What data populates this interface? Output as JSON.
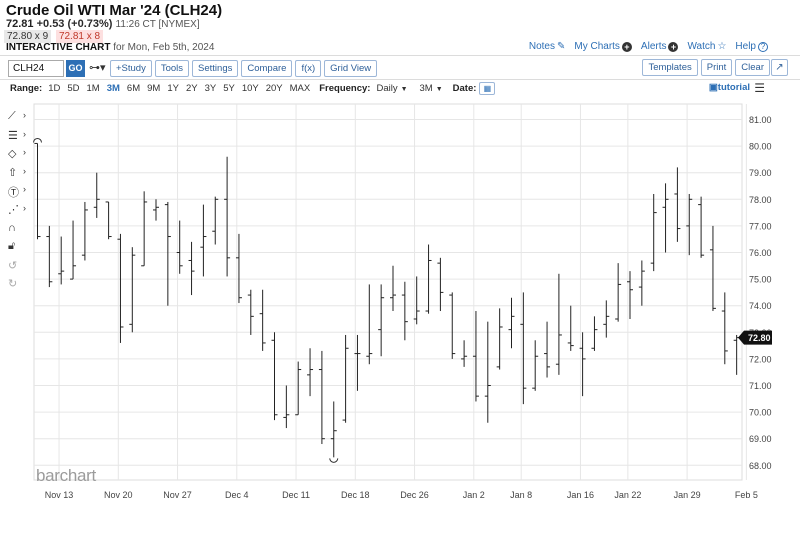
{
  "header": {
    "title": "Crude Oil WTI Mar '24 (CLH24)",
    "last": "72.81",
    "change": "+0.53 (+0.73%)",
    "time": "11:26 CT [NYMEX]",
    "bid": "72.80 x 9",
    "ask": "72.81 x 8",
    "chart_type_label": "INTERACTIVE CHART",
    "for_date": "for Mon, Feb 5th, 2024"
  },
  "links": {
    "notes": "Notes",
    "my_charts": "My Charts",
    "alerts": "Alerts",
    "watch": "Watch",
    "help": "Help"
  },
  "toolbar": {
    "symbol": "CLH24",
    "go": "GO",
    "study": "+Study",
    "tools": "Tools",
    "settings": "Settings",
    "compare": "Compare",
    "fx": "f(x)",
    "grid_view": "Grid View",
    "templates": "Templates",
    "print": "Print",
    "clear": "Clear"
  },
  "rangebar": {
    "range_label": "Range:",
    "ranges": [
      "1D",
      "5D",
      "1M",
      "3M",
      "6M",
      "9M",
      "1Y",
      "2Y",
      "3Y",
      "5Y",
      "10Y",
      "20Y",
      "MAX"
    ],
    "active_range": "3M",
    "frequency_label": "Frequency:",
    "frequency": "Daily",
    "period": "3M",
    "date_label": "Date:",
    "tutorial": "tutorial"
  },
  "logo": "barchart",
  "colors": {
    "accent": "#2d6fb5",
    "bars": "#222222",
    "grid": "#e6e6e6"
  },
  "chart_data": {
    "type": "ohlc",
    "title": "",
    "xlabel": "",
    "ylabel": "",
    "ylim": [
      67.5,
      81.5
    ],
    "yticks": [
      "81.00",
      "80.00",
      "79.00",
      "78.00",
      "77.00",
      "76.00",
      "75.00",
      "74.00",
      "73.00",
      "72.00",
      "71.00",
      "70.00",
      "69.00",
      "68.00"
    ],
    "xticks": [
      "Nov 13",
      "Nov 20",
      "Nov 27",
      "Dec 4",
      "Dec 11",
      "Dec 18",
      "Dec 26",
      "Jan 2",
      "Jan 8",
      "Jan 16",
      "Jan 22",
      "Jan 29",
      "Feb 5"
    ],
    "last_price_label": "72.80",
    "last_price": 72.8,
    "bars": [
      {
        "o": 80.1,
        "h": 80.1,
        "l": 76.5,
        "c": 76.6
      },
      {
        "o": 76.6,
        "h": 77.0,
        "l": 74.7,
        "c": 74.9
      },
      {
        "o": 75.2,
        "h": 76.6,
        "l": 74.8,
        "c": 75.3
      },
      {
        "o": 75.0,
        "h": 77.2,
        "l": 75.0,
        "c": 75.5
      },
      {
        "o": 75.9,
        "h": 77.9,
        "l": 75.7,
        "c": 77.6
      },
      {
        "o": 77.7,
        "h": 79.0,
        "l": 77.3,
        "c": 78.0
      },
      {
        "o": 77.9,
        "h": 77.9,
        "l": 76.5,
        "c": 76.6
      },
      {
        "o": 76.5,
        "h": 76.7,
        "l": 72.6,
        "c": 73.2
      },
      {
        "o": 73.3,
        "h": 76.2,
        "l": 73.0,
        "c": 75.9
      },
      {
        "o": 75.5,
        "h": 78.3,
        "l": 75.5,
        "c": 77.9
      },
      {
        "o": 77.6,
        "h": 78.0,
        "l": 77.2,
        "c": 77.7
      },
      {
        "o": 77.8,
        "h": 77.9,
        "l": 74.0,
        "c": 76.6
      },
      {
        "o": 76.0,
        "h": 77.2,
        "l": 75.2,
        "c": 75.5
      },
      {
        "o": 75.7,
        "h": 76.4,
        "l": 74.4,
        "c": 75.3
      },
      {
        "o": 76.2,
        "h": 77.8,
        "l": 75.1,
        "c": 76.6
      },
      {
        "o": 76.8,
        "h": 78.1,
        "l": 76.3,
        "c": 78.0
      },
      {
        "o": 78.0,
        "h": 79.6,
        "l": 75.1,
        "c": 75.8
      },
      {
        "o": 75.8,
        "h": 76.7,
        "l": 74.1,
        "c": 74.3
      },
      {
        "o": 74.4,
        "h": 74.6,
        "l": 72.9,
        "c": 73.6
      },
      {
        "o": 73.7,
        "h": 74.6,
        "l": 72.3,
        "c": 72.6
      },
      {
        "o": 72.7,
        "h": 73.0,
        "l": 69.7,
        "c": 69.9
      },
      {
        "o": 69.8,
        "h": 71.0,
        "l": 69.4,
        "c": 69.9
      },
      {
        "o": 69.9,
        "h": 71.9,
        "l": 69.9,
        "c": 71.6
      },
      {
        "o": 71.4,
        "h": 72.4,
        "l": 70.6,
        "c": 71.6
      },
      {
        "o": 71.6,
        "h": 72.3,
        "l": 68.8,
        "c": 69.0
      },
      {
        "o": 69.0,
        "h": 70.4,
        "l": 68.3,
        "c": 69.3
      },
      {
        "o": 69.7,
        "h": 72.9,
        "l": 69.6,
        "c": 72.4
      },
      {
        "o": 72.2,
        "h": 72.9,
        "l": 70.8,
        "c": 72.2
      },
      {
        "o": 72.1,
        "h": 74.8,
        "l": 71.8,
        "c": 72.2
      },
      {
        "o": 73.1,
        "h": 74.8,
        "l": 72.1,
        "c": 74.3
      },
      {
        "o": 74.3,
        "h": 75.5,
        "l": 73.8,
        "c": 74.4
      },
      {
        "o": 74.4,
        "h": 74.9,
        "l": 72.7,
        "c": 73.4
      },
      {
        "o": 73.5,
        "h": 75.1,
        "l": 73.3,
        "c": 73.8
      },
      {
        "o": 73.8,
        "h": 76.3,
        "l": 73.7,
        "c": 75.7
      },
      {
        "o": 75.6,
        "h": 75.8,
        "l": 73.8,
        "c": 74.5
      },
      {
        "o": 74.4,
        "h": 74.5,
        "l": 72.0,
        "c": 72.2
      },
      {
        "o": 72.0,
        "h": 72.7,
        "l": 71.7,
        "c": 72.1
      },
      {
        "o": 72.1,
        "h": 73.8,
        "l": 70.4,
        "c": 70.6
      },
      {
        "o": 70.6,
        "h": 73.4,
        "l": 69.6,
        "c": 71.0
      },
      {
        "o": 71.7,
        "h": 73.9,
        "l": 71.6,
        "c": 73.2
      },
      {
        "o": 73.1,
        "h": 74.3,
        "l": 72.4,
        "c": 73.6
      },
      {
        "o": 73.3,
        "h": 74.5,
        "l": 70.3,
        "c": 70.9
      },
      {
        "o": 70.9,
        "h": 72.7,
        "l": 70.8,
        "c": 72.1
      },
      {
        "o": 72.2,
        "h": 73.4,
        "l": 71.3,
        "c": 71.7
      },
      {
        "o": 71.8,
        "h": 75.2,
        "l": 71.4,
        "c": 72.9
      },
      {
        "o": 72.6,
        "h": 74.0,
        "l": 72.3,
        "c": 72.5
      },
      {
        "o": 72.4,
        "h": 73.0,
        "l": 70.6,
        "c": 72.0
      },
      {
        "o": 72.4,
        "h": 73.6,
        "l": 72.3,
        "c": 73.1
      },
      {
        "o": 73.3,
        "h": 74.2,
        "l": 72.8,
        "c": 73.6
      },
      {
        "o": 73.5,
        "h": 75.6,
        "l": 73.4,
        "c": 74.8
      },
      {
        "o": 74.9,
        "h": 75.3,
        "l": 73.5,
        "c": 74.6
      },
      {
        "o": 74.7,
        "h": 75.7,
        "l": 74.0,
        "c": 75.3
      },
      {
        "o": 75.6,
        "h": 78.2,
        "l": 75.3,
        "c": 77.5
      },
      {
        "o": 77.7,
        "h": 78.6,
        "l": 76.0,
        "c": 78.0
      },
      {
        "o": 78.2,
        "h": 79.2,
        "l": 76.4,
        "c": 76.9
      },
      {
        "o": 77.0,
        "h": 78.2,
        "l": 75.9,
        "c": 78.0
      },
      {
        "o": 77.8,
        "h": 78.1,
        "l": 75.8,
        "c": 75.9
      },
      {
        "o": 76.1,
        "h": 77.0,
        "l": 73.8,
        "c": 73.9
      },
      {
        "o": 73.8,
        "h": 74.5,
        "l": 71.8,
        "c": 72.3
      },
      {
        "o": 72.7,
        "h": 72.9,
        "l": 71.4,
        "c": 72.8
      }
    ]
  }
}
